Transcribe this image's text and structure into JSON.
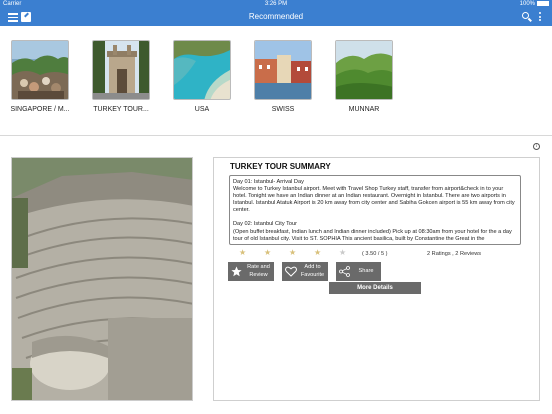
{
  "status_bar": {
    "carrier": "Carrier",
    "time": "3:26 PM",
    "battery": "100%"
  },
  "nav": {
    "title": "Recommended",
    "icons": [
      "menu-icon",
      "edit-icon",
      "search-icon",
      "more-vertical-icon"
    ]
  },
  "destinations": [
    {
      "label": "SINGAPORE / M..."
    },
    {
      "label": "TURKEY TOUR..."
    },
    {
      "label": "USA"
    },
    {
      "label": "SWISS"
    },
    {
      "label": "MUNNAR"
    }
  ],
  "summary": {
    "title": "TURKEY TOUR SUMMARY",
    "day1": "Day 01: Istanbul- Arrival Day\nWelcome to Turkey Istanbul airport. Meet with Travel Shop Turkey staff, transfer from airport&check in to your hotel. Tonight we have an Indian dinner at an Indian restaurant. Overnight in Istanbul. There are two airports in Istanbul. Istanbul Atatuk Airport is 20 km away from city center and Sabiha Gokcen airport is 55 km away from city center.",
    "day2": "Day 02: Istanbul City Tour\n(Open buffet breakfast, Indian lunch and Indian dinner included) Pick up at 08:30am from your hotel for the a day tour of old Istanbul city. Visit to ST. SOPHIA This ancient basilica, built by Constantine the Great in the",
    "rating": 3.5,
    "rating_text": "( 3.50 / 5 )",
    "ratings_count": "2 Ratings , 2 Reviews",
    "buttons": {
      "rate_review": "Rate and\nReview",
      "add_favourite": "Add to\nFavourite",
      "share": "Share",
      "more_details": "More Details"
    }
  },
  "colors": {
    "primary": "#3b7fd0",
    "button": "#6a6a6a",
    "star": "#d8c07a"
  }
}
